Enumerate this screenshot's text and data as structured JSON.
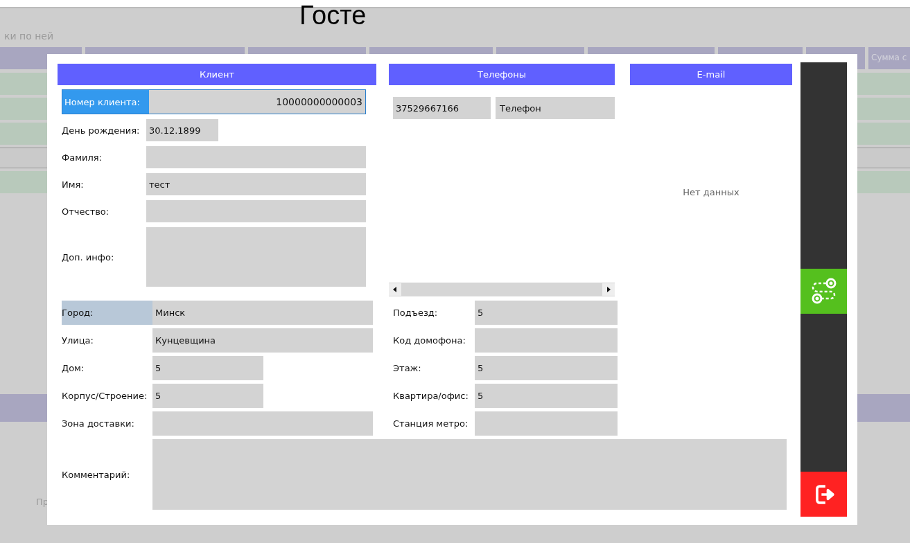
{
  "background": {
    "title": "Госте",
    "subtitle": "ки по ней",
    "column_header": "Сумма с",
    "footer_label": "Пр"
  },
  "client": {
    "header": "Клиент",
    "fields": [
      {
        "label": "Номер клиента:",
        "value": "10000000000003",
        "kind": "number",
        "selected": true
      },
      {
        "label": "День рождения:",
        "value": "30.12.1899",
        "kind": "short",
        "selected": false
      },
      {
        "label": "Фамиля:",
        "kind": "wide",
        "selected": false
      },
      {
        "label": "Имя:",
        "value": "тест",
        "kind": "wide",
        "selected": false
      },
      {
        "label": "Отчество:",
        "kind": "wide",
        "selected": false
      },
      {
        "label": "Доп. инфо:",
        "kind": "multiline",
        "selected": false
      }
    ]
  },
  "phones": {
    "header": "Телефоны",
    "items": [
      {
        "number": "37529667166",
        "type": "Телефон"
      }
    ]
  },
  "email": {
    "header": "E-mail",
    "empty_text": "Нет данных"
  },
  "address": {
    "left": [
      {
        "label": "Город:",
        "value": "Минск",
        "kind": "wide",
        "highlighted": true
      },
      {
        "label": "Улица:",
        "value": "Кунцевщина",
        "kind": "wide",
        "highlighted": false
      },
      {
        "label": "Дом:",
        "value": "5",
        "kind": "short",
        "highlighted": false
      },
      {
        "label": "Корпус/Строение:",
        "value": "5",
        "kind": "short",
        "highlighted": false
      },
      {
        "label": "Зона доставки:",
        "kind": "wide",
        "highlighted": false
      }
    ],
    "right": [
      {
        "label": "Подъезд:",
        "value": "5"
      },
      {
        "label": "Код домофона:"
      },
      {
        "label": "Этаж:",
        "value": "5"
      },
      {
        "label": "Квартира/офис:",
        "value": "5"
      },
      {
        "label": "Станция метро:"
      }
    ]
  },
  "comment": {
    "label": "Комментарий:"
  }
}
